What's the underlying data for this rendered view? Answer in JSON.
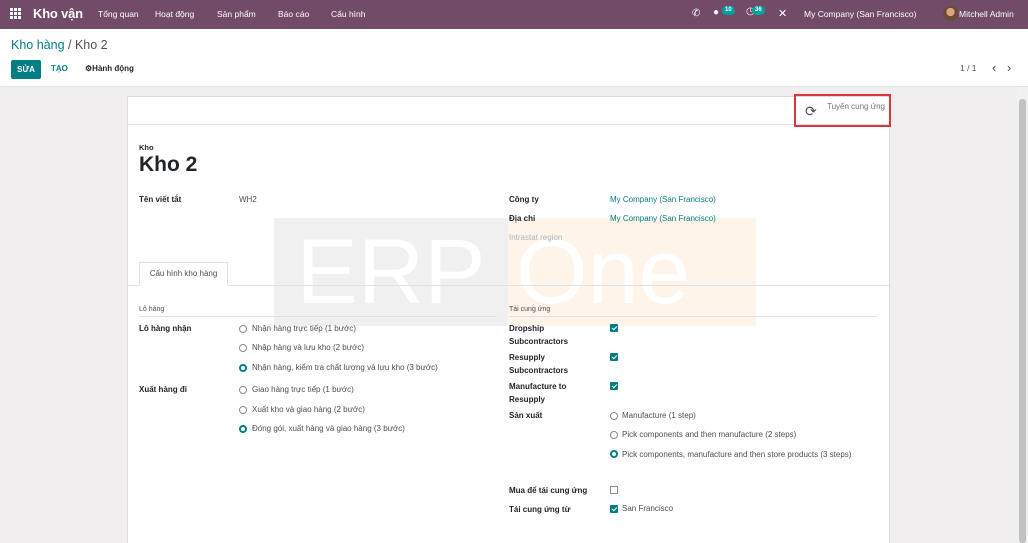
{
  "navbar": {
    "app_name": "Kho vận",
    "menus": [
      "Tổng quan",
      "Hoạt động",
      "Sản phẩm",
      "Báo cáo",
      "Cấu hình"
    ],
    "messages_count": "10",
    "activities_count": "36",
    "company": "My Company (San Francisco)",
    "user": "Mitchell Admin"
  },
  "control_panel": {
    "breadcrumb_parent": "Kho hàng",
    "breadcrumb_sep": " / ",
    "breadcrumb_current": "Kho 2",
    "edit_label": "SỬA",
    "create_label": "TẠO",
    "action_label": "Hành động",
    "pager": "1 / 1"
  },
  "statusbar": {
    "replenish_label": "Tuyến cung ứng"
  },
  "watermark": {
    "part1": "ERP",
    "part2": "One"
  },
  "form": {
    "name_label": "Kho",
    "name": "Kho 2",
    "short_name_label": "Tên viết tắt",
    "short_name": "WH2",
    "company_label": "Công ty",
    "company": "My Company (San Francisco)",
    "address_label": "Địa chỉ",
    "address": "My Company (San Francisco)",
    "intrastat_placeholder": "Intrastat region",
    "tab": "Cấu hình kho hàng"
  },
  "shipments": {
    "section": "Lô hàng",
    "incoming_label": "Lô hàng nhận",
    "incoming_options": [
      "Nhận hàng trực tiếp (1 bước)",
      "Nhập hàng và lưu kho (2 bước)",
      "Nhận hàng, kiểm tra chất lượng và lưu kho (3 bước)"
    ],
    "incoming_selected": 2,
    "outgoing_label": "Xuất hàng đi",
    "outgoing_options": [
      "Giao hàng trực tiếp (1 bước)",
      "Xuất kho và giao hàng (2 bước)",
      "Đóng gói, xuất hàng và giao hàng (3 bước)"
    ],
    "outgoing_selected": 2
  },
  "resupply": {
    "section": "Tái cung ứng",
    "dropship_label": "Dropship Subcontractors",
    "dropship_checked": true,
    "resupply_sub_label": "Resupply Subcontractors",
    "resupply_sub_checked": true,
    "mto_label": "Manufacture to Resupply",
    "mto_checked": true,
    "manufacture_label": "Sản xuất",
    "manufacture_options": [
      "Manufacture (1 step)",
      "Pick components and then manufacture (2 steps)",
      "Pick components, manufacture and then store products (3 steps)"
    ],
    "manufacture_selected": 2,
    "buy_label": "Mua để tái cung ứng",
    "buy_checked": false,
    "resupply_from_label": "Tái cung ứng từ",
    "resupply_from_value": "San Francisco",
    "resupply_from_checked": true
  }
}
